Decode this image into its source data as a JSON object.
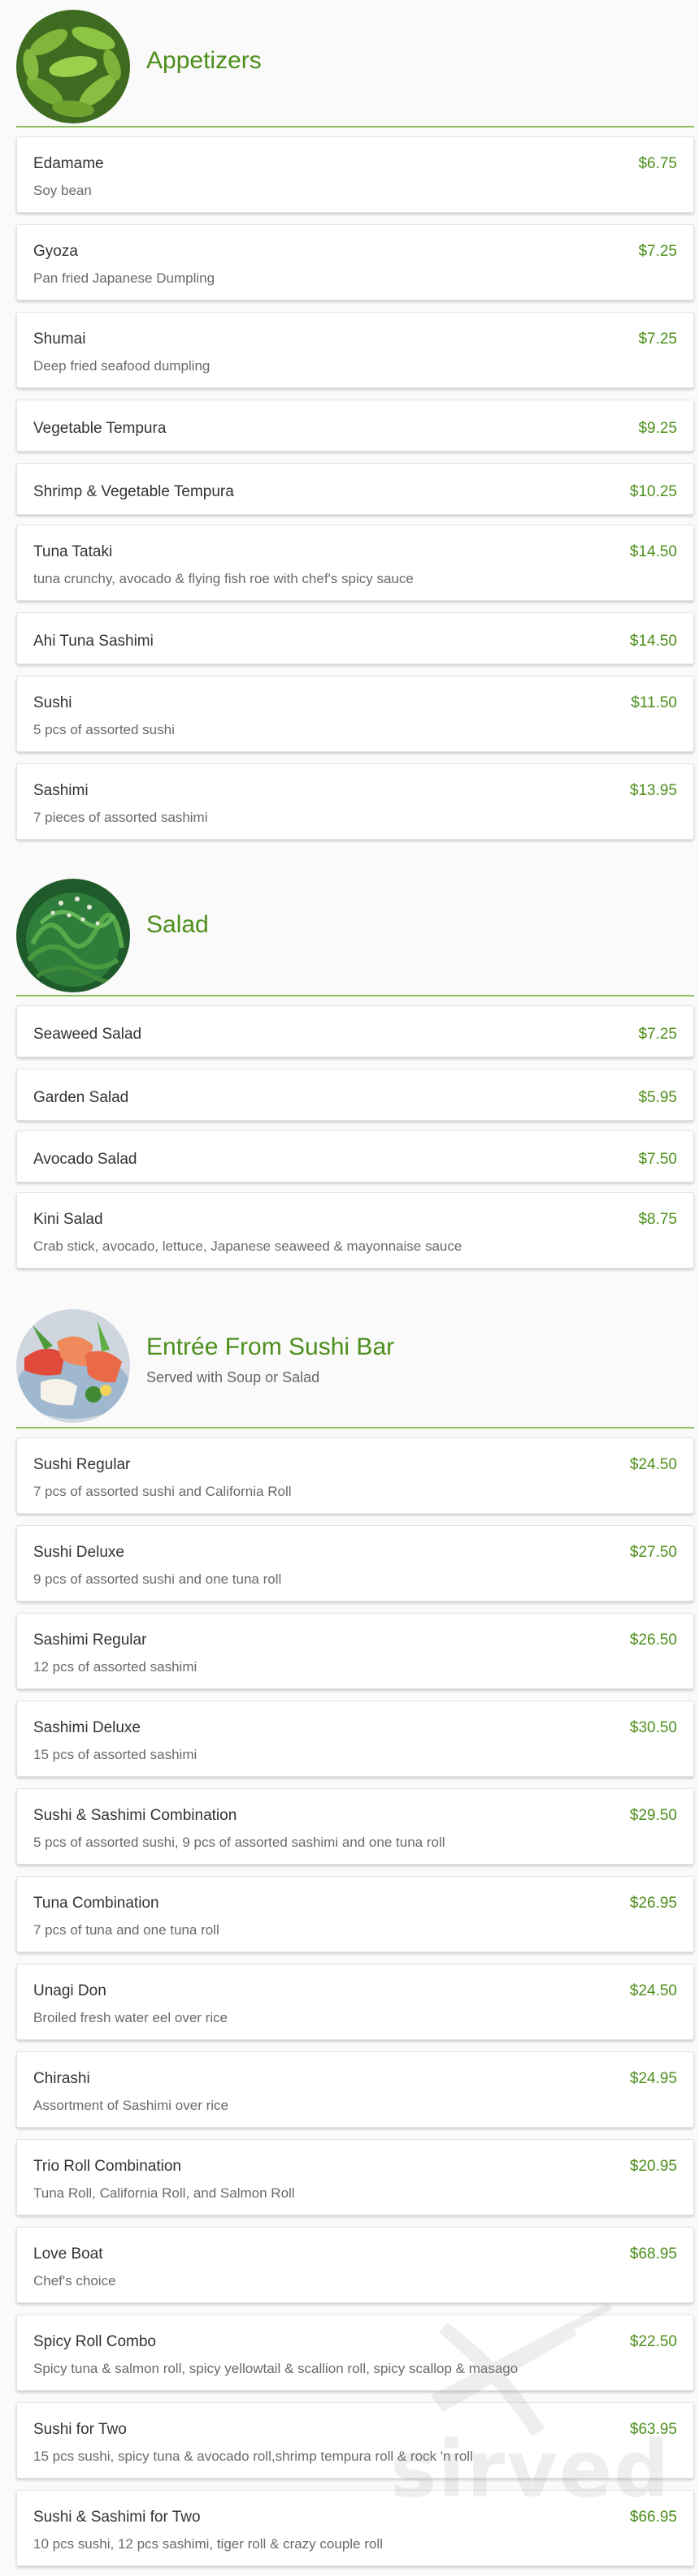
{
  "colors": {
    "accent": "#4d8f1c",
    "rule": "#8bbf5a",
    "card": "#ffffff",
    "background": "#fafafa"
  },
  "sections": [
    {
      "title": "Appetizers",
      "image": "edamame-photo",
      "items": [
        {
          "name": "Edamame",
          "price": "$6.75",
          "desc": "Soy bean"
        },
        {
          "name": "Gyoza",
          "price": "$7.25",
          "desc": "Pan fried Japanese Dumpling"
        },
        {
          "name": "Shumai",
          "price": "$7.25",
          "desc": "Deep fried seafood dumpling"
        },
        {
          "name": "Vegetable Tempura",
          "price": "$9.25"
        },
        {
          "name": "Shrimp & Vegetable Tempura",
          "price": "$10.25"
        },
        {
          "name": "Tuna Tataki",
          "price": "$14.50",
          "desc": "tuna crunchy, avocado & flying fish roe with chef's spicy sauce"
        },
        {
          "name": "Ahi Tuna Sashimi",
          "price": "$14.50"
        },
        {
          "name": "Sushi",
          "price": "$11.50",
          "desc": "5 pcs of assorted sushi"
        },
        {
          "name": "Sashimi",
          "price": "$13.95",
          "desc": "7 pieces of assorted sashimi"
        }
      ]
    },
    {
      "title": "Salad",
      "image": "seaweed-salad-photo",
      "items": [
        {
          "name": "Seaweed Salad",
          "price": "$7.25"
        },
        {
          "name": "Garden Salad",
          "price": "$5.95"
        },
        {
          "name": "Avocado Salad",
          "price": "$7.50"
        },
        {
          "name": "Kini Salad",
          "price": "$8.75",
          "desc": "Crab stick, avocado, lettuce, Japanese seaweed & mayonnaise sauce"
        }
      ]
    },
    {
      "title": "Entrée From Sushi Bar",
      "subtitle": "Served with Soup or Salad",
      "image": "sashimi-platter-photo",
      "items": [
        {
          "name": "Sushi Regular",
          "price": "$24.50",
          "desc": "7 pcs of assorted sushi and California Roll"
        },
        {
          "name": "Sushi Deluxe",
          "price": "$27.50",
          "desc": "9 pcs of assorted sushi and one tuna roll"
        },
        {
          "name": "Sashimi Regular",
          "price": "$26.50",
          "desc": "12 pcs of assorted sashimi"
        },
        {
          "name": "Sashimi Deluxe",
          "price": "$30.50",
          "desc": "15 pcs of assorted sashimi"
        },
        {
          "name": "Sushi & Sashimi Combination",
          "price": "$29.50",
          "desc": "5 pcs of assorted sushi, 9 pcs of assorted sashimi and one tuna roll"
        },
        {
          "name": "Tuna Combination",
          "price": "$26.95",
          "desc": "7 pcs of tuna and one tuna roll"
        },
        {
          "name": "Unagi Don",
          "price": "$24.50",
          "desc": "Broiled fresh water eel over rice"
        },
        {
          "name": "Chirashi",
          "price": "$24.95",
          "desc": "Assortment of Sashimi over rice"
        },
        {
          "name": "Trio Roll Combination",
          "price": "$20.95",
          "desc": "Tuna Roll, California Roll, and Salmon Roll"
        },
        {
          "name": "Love Boat",
          "price": "$68.95",
          "desc": "Chef's choice"
        },
        {
          "name": "Spicy Roll Combo",
          "price": "$22.50",
          "desc": "Spicy tuna & salmon roll, spicy yellowtail & scallion roll, spicy scallop & masago"
        },
        {
          "name": "Sushi for Two",
          "price": "$63.95",
          "desc": "15 pcs sushi, spicy tuna & avocado roll,shrimp tempura roll & rock 'n roll"
        },
        {
          "name": "Sushi & Sashimi for Two",
          "price": "$66.95",
          "desc": "10 pcs sushi, 12 pcs sashimi, tiger roll & crazy couple roll"
        }
      ]
    }
  ],
  "watermark": {
    "text": "sirved",
    "icon": "fork-knife-icon"
  }
}
